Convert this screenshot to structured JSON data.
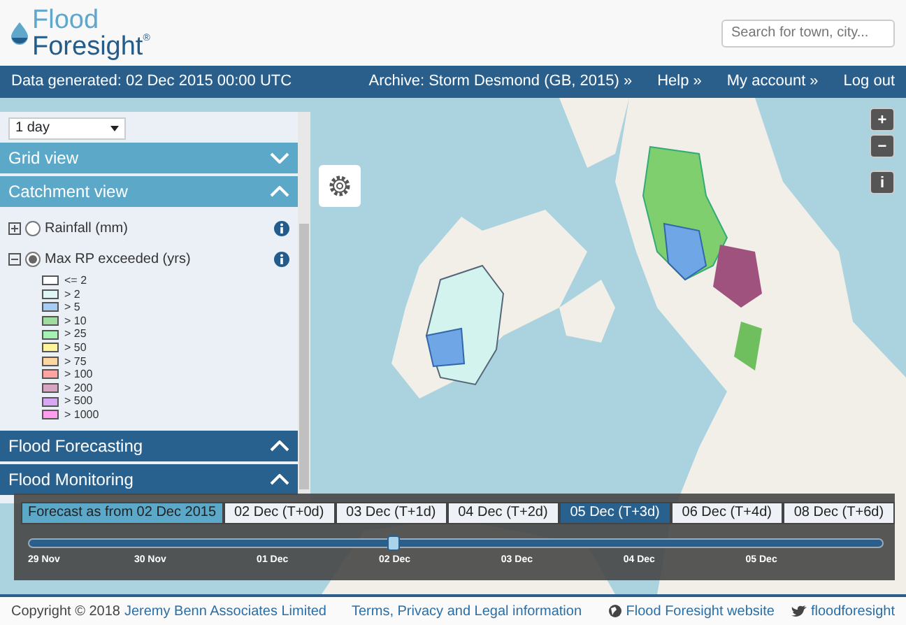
{
  "logo": {
    "line1": "Flood",
    "line2": "Foresight",
    "mark": "®"
  },
  "search": {
    "placeholder": "Search for town, city..."
  },
  "navbar": {
    "status": "Data generated: 02 Dec 2015 00:00 UTC",
    "links": [
      {
        "label": "Archive: Storm Desmond (GB, 2015)",
        "chevron": "»"
      },
      {
        "label": "Help",
        "chevron": "»"
      },
      {
        "label": "My account",
        "chevron": "»"
      },
      {
        "label": "Log out"
      }
    ]
  },
  "map": {
    "controls": [
      "+",
      "−",
      "i"
    ]
  },
  "sidebar": {
    "period": "1 day",
    "sections": [
      {
        "title": "Grid view",
        "kind": "light",
        "expanded": false
      },
      {
        "title": "Catchment view",
        "kind": "light",
        "expanded": true,
        "layers": [
          {
            "label": "Rainfall (mm)",
            "selected": false,
            "expanded": false
          },
          {
            "label": "Max RP exceeded (yrs)",
            "selected": true,
            "expanded": true,
            "legend": [
              {
                "label": "<= 2",
                "color": "#ffffff"
              },
              {
                "label": "> 2",
                "color": "#dff7f4"
              },
              {
                "label": "> 5",
                "color": "#a8cdf4"
              },
              {
                "label": "> 10",
                "color": "#9fdc9f"
              },
              {
                "label": "> 25",
                "color": "#a6f2b4"
              },
              {
                "label": "> 50",
                "color": "#fff59a"
              },
              {
                "label": "> 75",
                "color": "#ffd6a0"
              },
              {
                "label": "> 100",
                "color": "#ffa3a3"
              },
              {
                "label": "> 200",
                "color": "#d9a3c3"
              },
              {
                "label": "> 500",
                "color": "#d9a6f5"
              },
              {
                "label": "> 1000",
                "color": "#ff9cf0"
              }
            ]
          }
        ]
      },
      {
        "title": "Flood Forecasting",
        "kind": "dark",
        "expanded": true
      },
      {
        "title": "Flood Monitoring",
        "kind": "dark",
        "expanded": true
      }
    ]
  },
  "timeline": {
    "forecast_label": "Forecast as from 02 Dec 2015",
    "tabs": [
      {
        "label": "02 Dec (T+0d)",
        "selected": false
      },
      {
        "label": "03 Dec (T+1d)",
        "selected": false
      },
      {
        "label": "04 Dec (T+2d)",
        "selected": false
      },
      {
        "label": "05 Dec (T+3d)",
        "selected": true
      },
      {
        "label": "06 Dec (T+4d)",
        "selected": false
      },
      {
        "label": "08 Dec (T+6d)",
        "selected": false
      }
    ],
    "level": 0.4286,
    "ticks": [
      "29 Nov",
      "30 Nov",
      "01 Dec",
      "02 Dec",
      "03 Dec",
      "04 Dec",
      "05 Dec"
    ]
  },
  "footer": {
    "copyright": "Copyright © 2018",
    "company": "Jeremy Benn Associates Limited",
    "terms": "Terms, Privacy and Legal information",
    "website": "Flood Foresight website",
    "twitter": "floodforesight"
  }
}
